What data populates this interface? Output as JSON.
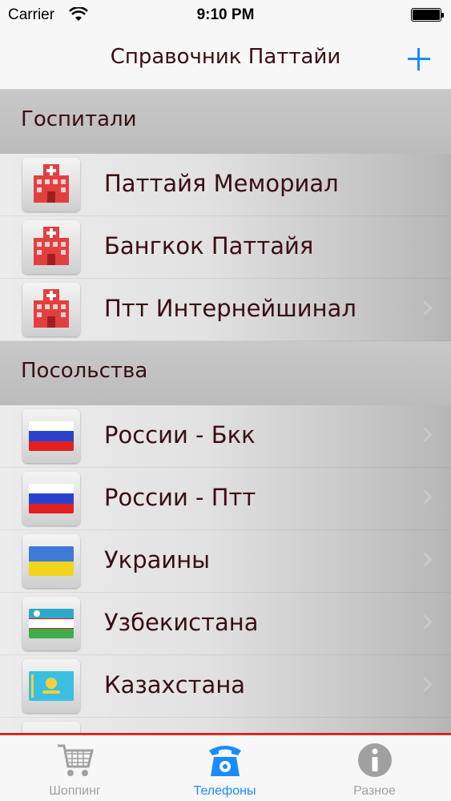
{
  "status": {
    "carrier": "Carrier",
    "time": "9:10 PM"
  },
  "nav": {
    "title": "Справочник Паттайи"
  },
  "sections": [
    {
      "title": "Госпитали",
      "rows": [
        {
          "label": "Паттайя Мемориал",
          "icon": "hospital-icon",
          "chevron": false
        },
        {
          "label": "Бангкок Паттайя",
          "icon": "hospital-icon",
          "chevron": false
        },
        {
          "label": "Птт Интернейшинал",
          "icon": "hospital-icon",
          "chevron": true
        }
      ]
    },
    {
      "title": "Посольства",
      "rows": [
        {
          "label": "России - Бкк",
          "icon": "russia-flag-icon",
          "chevron": true
        },
        {
          "label": "России - Птт",
          "icon": "russia-flag-icon",
          "chevron": true
        },
        {
          "label": "Украины",
          "icon": "ukraine-flag-icon",
          "chevron": true
        },
        {
          "label": "Узбекистана",
          "icon": "uzbekistan-flag-icon",
          "chevron": true
        },
        {
          "label": "Казахстана",
          "icon": "kazakhstan-flag-icon",
          "chevron": true
        }
      ]
    }
  ],
  "tabs": [
    {
      "label": "Шоппинг",
      "icon": "shopping-cart-icon",
      "active": false
    },
    {
      "label": "Телефоны",
      "icon": "telephone-icon",
      "active": true
    },
    {
      "label": "Разное",
      "icon": "info-icon",
      "active": false
    }
  ],
  "colors": {
    "accent": "#1a8cff",
    "text": "#3a0e12",
    "tab_inactive": "#a0a0a0",
    "tabbar_line": "#d22a2a"
  }
}
